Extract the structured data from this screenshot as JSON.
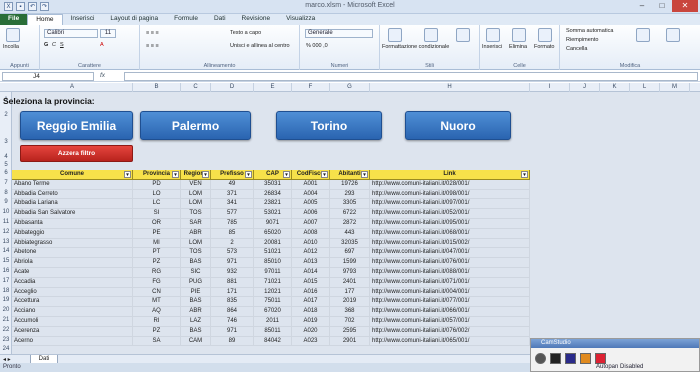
{
  "app": {
    "title": "marco.xlsm - Microsoft Excel"
  },
  "tabs": [
    "File",
    "Home",
    "Inserisci",
    "Layout di pagina",
    "Formule",
    "Dati",
    "Revisione",
    "Visualizza"
  ],
  "ribbon": {
    "incolla": "Incolla",
    "font_name": "Calibri",
    "font_size": "11",
    "testo_a_capo": "Testo a capo",
    "unisci": "Unisci e allinea al centro",
    "number_format": "Generale",
    "formattazione": "Formattazione condizionale",
    "formatta_tabella": "Formatta come tabella",
    "stili_cella": "Stili cella",
    "inserisci": "Inserisci",
    "elimina": "Elimina",
    "formato": "Formato",
    "somma": "Somma automatica",
    "riempimento": "Riempimento",
    "cancella": "Cancella",
    "ordina": "Ordina e filtra",
    "trova": "Trova e seleziona",
    "groups": [
      "Appunti",
      "Carattere",
      "Allineamento",
      "Numeri",
      "Stili",
      "Celle",
      "Modifica"
    ]
  },
  "formula_bar": {
    "name_box": "J4",
    "fx": "fx",
    "content": ""
  },
  "columns": [
    "A",
    "B",
    "C",
    "D",
    "E",
    "F",
    "G",
    "H",
    "I",
    "J",
    "K",
    "L",
    "M"
  ],
  "rows": [
    "1",
    "2",
    "3",
    "4",
    "5",
    "6",
    "7",
    "8",
    "9",
    "10",
    "11",
    "12",
    "13",
    "14",
    "15",
    "16",
    "17",
    "18",
    "19",
    "20",
    "21",
    "22",
    "23",
    "24",
    "25"
  ],
  "sheet": {
    "heading": "Seleziona la provincia:",
    "buttons": [
      "Reggio Emilia",
      "Palermo",
      "Torino",
      "Nuoro"
    ],
    "reset": "Azzera filtro"
  },
  "table": {
    "headers": [
      "Comune",
      "Provincia",
      "Regione",
      "Prefisso",
      "CAP",
      "CodFisco",
      "Abitanti",
      "Link"
    ],
    "rows": [
      [
        "Abano Terme",
        "PD",
        "VEN",
        "49",
        "35031",
        "A001",
        "19726",
        "http://www.comuni-italiani.it/028/001/"
      ],
      [
        "Abbadia Cerreto",
        "LO",
        "LOM",
        "371",
        "26834",
        "A004",
        "293",
        "http://www.comuni-italiani.it/098/001/"
      ],
      [
        "Abbadia Lariana",
        "LC",
        "LOM",
        "341",
        "23821",
        "A005",
        "3305",
        "http://www.comuni-italiani.it/097/001/"
      ],
      [
        "Abbadia San Salvatore",
        "SI",
        "TOS",
        "577",
        "53021",
        "A006",
        "6722",
        "http://www.comuni-italiani.it/052/001/"
      ],
      [
        "Abbasanta",
        "OR",
        "SAR",
        "785",
        "9071",
        "A007",
        "2872",
        "http://www.comuni-italiani.it/095/001/"
      ],
      [
        "Abbateggio",
        "PE",
        "ABR",
        "85",
        "65020",
        "A008",
        "443",
        "http://www.comuni-italiani.it/068/001/"
      ],
      [
        "Abbiategrasso",
        "MI",
        "LOM",
        "2",
        "20081",
        "A010",
        "32035",
        "http://www.comuni-italiani.it/015/002/"
      ],
      [
        "Abetone",
        "PT",
        "TOS",
        "573",
        "51021",
        "A012",
        "697",
        "http://www.comuni-italiani.it/047/001/"
      ],
      [
        "Abriola",
        "PZ",
        "BAS",
        "971",
        "85010",
        "A013",
        "1599",
        "http://www.comuni-italiani.it/076/001/"
      ],
      [
        "Acate",
        "RG",
        "SIC",
        "932",
        "97011",
        "A014",
        "9793",
        "http://www.comuni-italiani.it/088/001/"
      ],
      [
        "Accadia",
        "FG",
        "PUG",
        "881",
        "71021",
        "A015",
        "2401",
        "http://www.comuni-italiani.it/071/001/"
      ],
      [
        "Acceglio",
        "CN",
        "PIE",
        "171",
        "12021",
        "A016",
        "177",
        "http://www.comuni-italiani.it/004/001/"
      ],
      [
        "Accettura",
        "MT",
        "BAS",
        "835",
        "75011",
        "A017",
        "2019",
        "http://www.comuni-italiani.it/077/001/"
      ],
      [
        "Acciano",
        "AQ",
        "ABR",
        "864",
        "67020",
        "A018",
        "368",
        "http://www.comuni-italiani.it/066/001/"
      ],
      [
        "Accumoli",
        "RI",
        "LAZ",
        "746",
        "2011",
        "A019",
        "702",
        "http://www.comuni-italiani.it/057/001/"
      ],
      [
        "Acerenza",
        "PZ",
        "BAS",
        "971",
        "85011",
        "A020",
        "2595",
        "http://www.comuni-italiani.it/076/002/"
      ],
      [
        "Acerno",
        "SA",
        "CAM",
        "89",
        "84042",
        "A023",
        "2901",
        "http://www.comuni-italiani.it/065/001/"
      ]
    ]
  },
  "sheet_tab": "Dati",
  "status": "Pronto",
  "camstudio": {
    "title": "CamStudio"
  },
  "autopan": "Autopan Disabled"
}
